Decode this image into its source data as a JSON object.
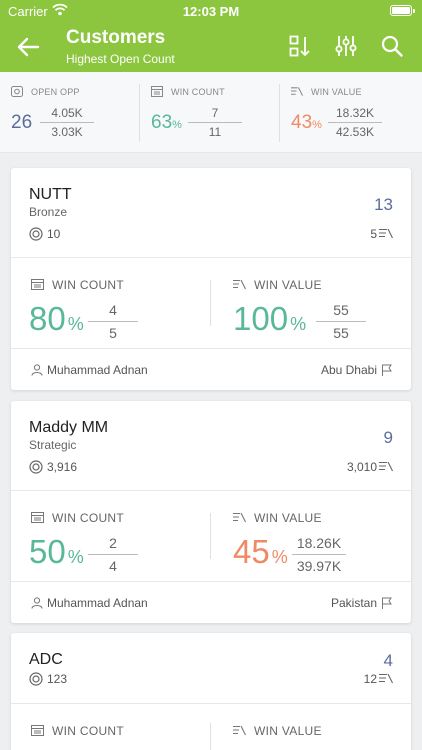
{
  "status": {
    "carrier": "Carrier",
    "time": "12:03 PM"
  },
  "nav": {
    "title": "Customers",
    "subtitle": "Highest Open Count",
    "icons": [
      "back-arrow-icon",
      "sort-icon",
      "filter-sliders-icon",
      "search-icon"
    ]
  },
  "summary": {
    "open_opp": {
      "label": "OPEN OPP",
      "value": "26",
      "top": "4.05K",
      "bottom": "3.03K"
    },
    "win_count": {
      "label": "WIN COUNT",
      "value": "63",
      "unit": "%",
      "top": "7",
      "bottom": "11"
    },
    "win_value": {
      "label": "WIN VALUE",
      "value": "43",
      "unit": "%",
      "top": "18.32K",
      "bottom": "42.53K"
    }
  },
  "labels": {
    "win_count": "WIN COUNT",
    "win_value": "WIN VALUE",
    "percent": "%"
  },
  "colors": {
    "header": "#8cc63f",
    "count_blue": "#5b6d9c",
    "green": "#59b79a",
    "orange": "#ef8a66"
  },
  "customers": [
    {
      "name": "NUTT",
      "tier": "Bronze",
      "count": "13",
      "open": "10",
      "value": "5",
      "win_count": {
        "pct": "80",
        "top": "4",
        "bottom": "5"
      },
      "win_value": {
        "pct": "100",
        "top": "55",
        "bottom": "55"
      },
      "owner": "Muhammad Adnan",
      "location": "Abu Dhabi"
    },
    {
      "name": "Maddy MM",
      "tier": "Strategic",
      "count": "9",
      "open": "3,916",
      "value": "3,010",
      "win_count": {
        "pct": "50",
        "top": "2",
        "bottom": "4"
      },
      "win_value": {
        "pct": "45",
        "top": "18.26K",
        "bottom": "39.97K"
      },
      "owner": "Muhammad Adnan",
      "location": "Pakistan"
    },
    {
      "name": "ADC",
      "tier": "",
      "count": "4",
      "open": "123",
      "value": "12"
    }
  ]
}
